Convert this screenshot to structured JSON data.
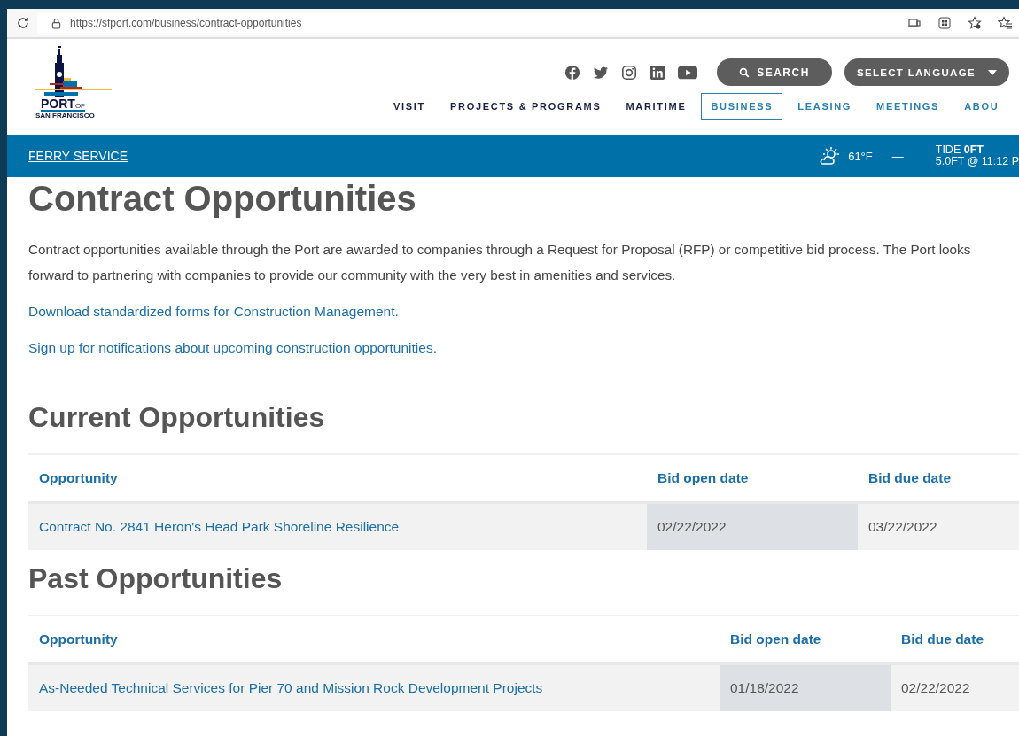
{
  "browser": {
    "url": "https://sfport.com/business/contract-opportunities"
  },
  "header": {
    "logo": {
      "name": "PORT",
      "of": "OF",
      "city": "SAN FRANCISCO"
    },
    "search_button": "SEARCH",
    "language_button": "SELECT LANGUAGE",
    "nav": [
      {
        "label": "VISIT",
        "kind": "primary",
        "selected": false
      },
      {
        "label": "PROJECTS & PROGRAMS",
        "kind": "primary",
        "selected": false
      },
      {
        "label": "MARITIME",
        "kind": "primary",
        "selected": false
      },
      {
        "label": "BUSINESS",
        "kind": "secondary",
        "selected": true
      },
      {
        "label": "LEASING",
        "kind": "secondary",
        "selected": false
      },
      {
        "label": "MEETINGS",
        "kind": "secondary",
        "selected": false
      },
      {
        "label": "ABOU",
        "kind": "secondary",
        "selected": false
      }
    ]
  },
  "utility_bar": {
    "link": "FERRY SERVICE",
    "temperature": "61°F",
    "separator": "—",
    "tide": "TIDE **0FT**",
    "tide_next": "5.0FT @ 11:12 P"
  },
  "title": "Contract Opportunities",
  "intro": "Contract opportunities available through the Port are awarded to companies through a Request for Proposal (RFP) or competitive bid process. The Port looks forward to partnering with companies to provide our community with the very best in amenities and services.",
  "links": [
    "Download standardized forms for Construction Management.",
    "Sign up for notifications about upcoming construction opportunities."
  ],
  "sections": [
    {
      "heading": "Current Opportunities",
      "columns": [
        "Opportunity",
        "Bid open date",
        "Bid due date"
      ],
      "rows": [
        {
          "cells": [
            "Contract No. 2841 Heron's Head Park Shoreline Resilience",
            "02/22/2022",
            "03/22/2022"
          ]
        }
      ]
    },
    {
      "heading": "Past Opportunities",
      "columns": [
        "Opportunity",
        "Bid open date",
        "Bid due date"
      ],
      "rows": [
        {
          "cells": [
            "As-Needed Technical Services for Pier 70 and Mission Rock Development Projects",
            "01/18/2022",
            "02/22/2022"
          ]
        }
      ]
    }
  ]
}
